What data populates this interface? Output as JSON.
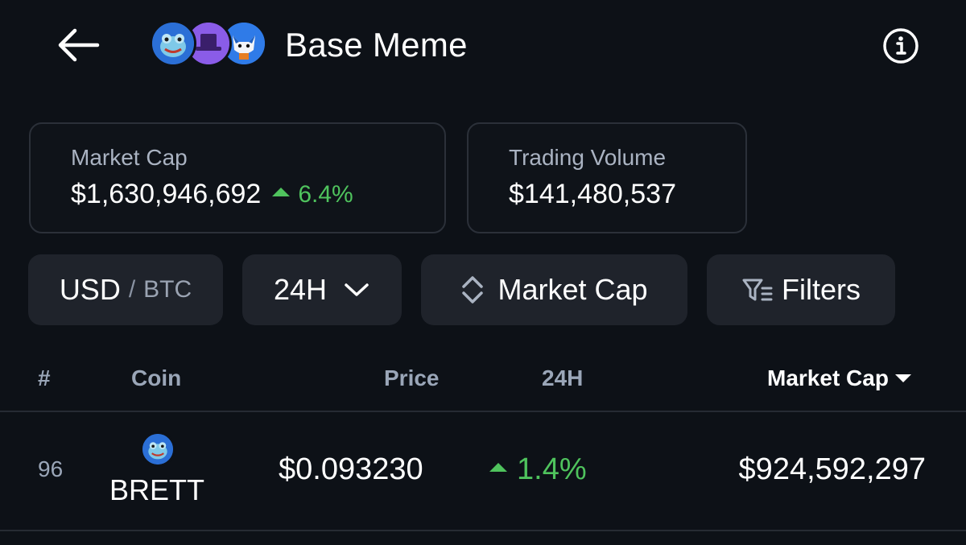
{
  "header": {
    "title": "Base Meme",
    "back_icon": "arrow-left-icon",
    "info_icon": "info-icon",
    "avatars": [
      "brett-avatar",
      "top-hat-avatar",
      "fox-avatar"
    ]
  },
  "stats": {
    "market_cap_label": "Market Cap",
    "market_cap_value": "$1,630,946,692",
    "market_cap_change": "6.4%",
    "volume_label": "Trading Volume",
    "volume_value": "$141,480,537"
  },
  "controls": {
    "currency_primary": "USD",
    "currency_sep": "/",
    "currency_secondary": "BTC",
    "period": "24H",
    "sort": "Market Cap",
    "filters": "Filters"
  },
  "table": {
    "headers": {
      "rank": "#",
      "coin": "Coin",
      "price": "Price",
      "change": "24H",
      "market_cap": "Market Cap"
    },
    "rows": [
      {
        "rank": "96",
        "symbol": "BRETT",
        "price": "$0.093230",
        "change": "1.4%",
        "market_cap": "$924,592,297"
      }
    ]
  },
  "colors": {
    "background": "#0d1117",
    "positive": "#4fc35d",
    "pill_bg": "#1f232b",
    "muted_text": "#9aa6b8"
  }
}
